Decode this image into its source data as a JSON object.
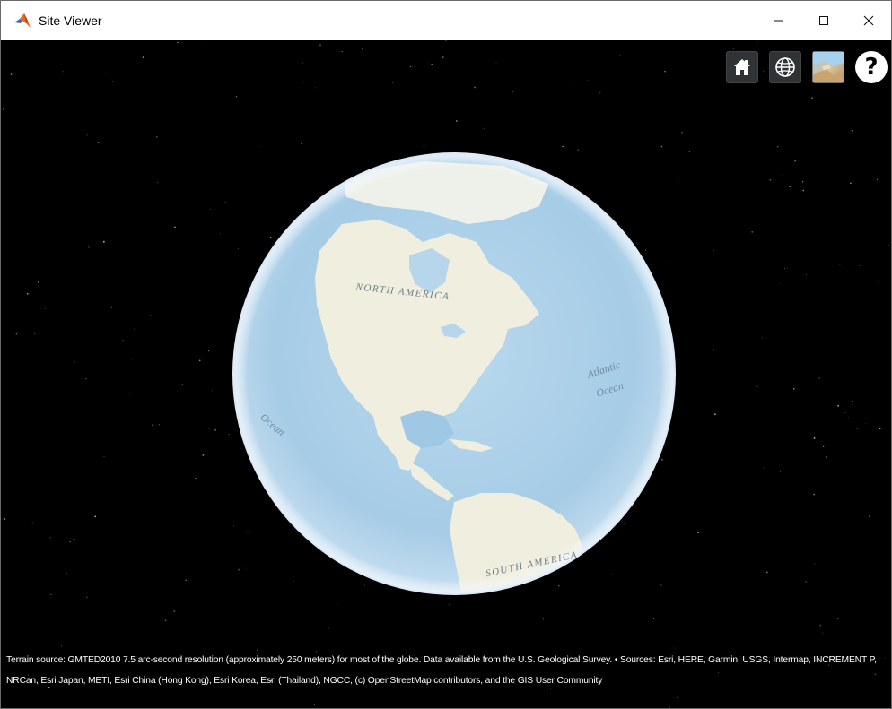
{
  "window": {
    "title": "Site Viewer",
    "controls": {
      "minimize": "–",
      "maximize": "☐",
      "close": "✕"
    }
  },
  "toolbar": {
    "home_icon": "home-icon",
    "scene_mode_icon": "globe-icon",
    "imagery_icon": "base-layer-picker-icon",
    "help_label": "?"
  },
  "map": {
    "labels": {
      "north_america": "NORTH AMERICA",
      "south_america": "SOUTH AMERICA",
      "atlantic_1": "Atlantic",
      "atlantic_2": "Ocean",
      "pacific": "Ocean"
    },
    "colors": {
      "ocean": "#a9cde6",
      "land": "#f0eee0",
      "space": "#000000"
    }
  },
  "attribution": {
    "text": "Terrain source: GMTED2010 7.5 arc-second resolution (approximately 250 meters) for most of the globe. Data available from the U.S. Geological Survey. • Sources: Esri, HERE, Garmin, USGS, Intermap, INCREMENT P, NRCan, Esri Japan, METI, Esri China (Hong Kong), Esri Korea, Esri (Thailand), NGCC, (c) OpenStreetMap contributors, and the GIS User Community"
  }
}
